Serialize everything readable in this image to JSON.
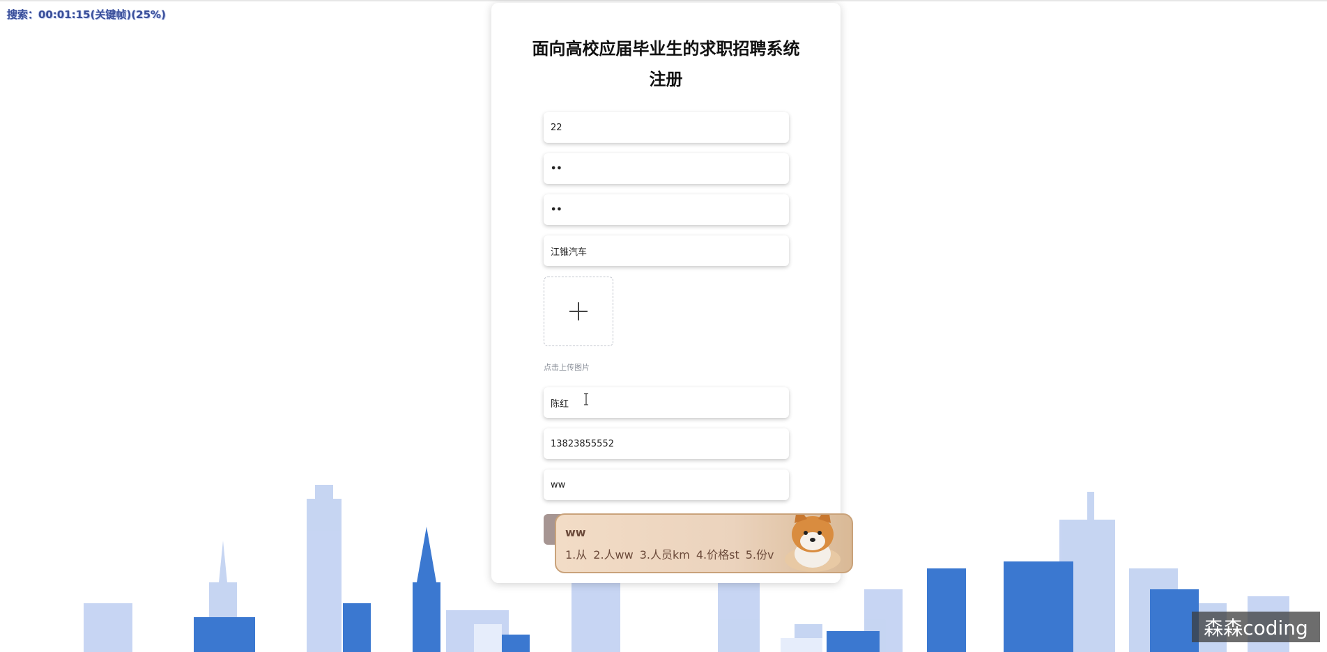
{
  "recording": {
    "status_text": "搜索：00:01:15(关键帧)(25%)"
  },
  "form": {
    "title_line1": "面向高校应届毕业生的求职招聘系统",
    "title_line2": "注册",
    "fields": [
      {
        "value": "22"
      },
      {
        "value": "••"
      },
      {
        "value": "••"
      },
      {
        "value": "江锥汽车"
      },
      {
        "value": "陈红"
      },
      {
        "value": "13823855552"
      },
      {
        "value": "ww"
      }
    ],
    "upload_hint": "点击上传图片"
  },
  "ime": {
    "composition": "ww",
    "candidates": [
      "1.从",
      "2.人ww",
      "3.人员km",
      "4.价格st",
      "5.份v"
    ]
  },
  "watermark": {
    "text": "森森coding"
  },
  "colors": {
    "submit_button": "#a69592",
    "skyline_light": "#c4d3f2",
    "skyline_dark": "#3b78d0"
  }
}
